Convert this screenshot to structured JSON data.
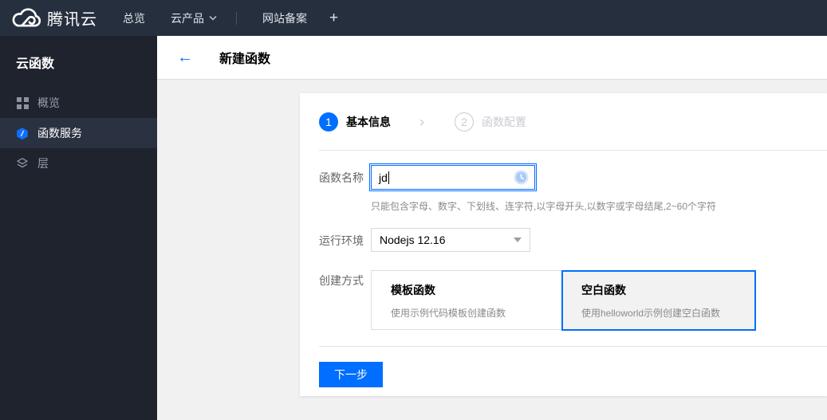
{
  "colors": {
    "accent": "#006eff",
    "topnav_bg": "#262f3e",
    "sidebar_bg": "#1e232e",
    "sidebar_selected_bg": "#2a3140",
    "content_bg": "#f1f1f1",
    "muted_text": "#8a8a8a"
  },
  "topnav": {
    "brand": "腾讯云",
    "items": [
      {
        "label": "总览"
      },
      {
        "label": "云产品"
      },
      {
        "label": "网站备案"
      },
      {
        "label": "+"
      }
    ]
  },
  "sidebar": {
    "title": "云函数",
    "items": [
      {
        "label": "概览",
        "icon": "overview-grid-icon",
        "selected": false
      },
      {
        "label": "函数服务",
        "icon": "function-service-hexagon-icon",
        "selected": true
      },
      {
        "label": "层",
        "icon": "layers-icon",
        "selected": false
      }
    ]
  },
  "header": {
    "back": "←",
    "title": "新建函数"
  },
  "wizard": {
    "separator": "›",
    "steps": [
      {
        "number": "1",
        "label": "基本信息",
        "active": true
      },
      {
        "number": "2",
        "label": "函数配置",
        "active": false
      }
    ]
  },
  "form": {
    "name_label": "函数名称",
    "name_value": "jd",
    "name_status_icon": "pending-clock-icon",
    "name_hint": "只能包含字母、数字、下划线、连字符,以字母开头,以数字或字母结尾,2~60个字符",
    "runtime_label": "运行环境",
    "runtime_value": "Nodejs 12.16",
    "method_label": "创建方式",
    "methods": [
      {
        "title": "模板函数",
        "desc": "使用示例代码模板创建函数",
        "selected": false
      },
      {
        "title": "空白函数",
        "desc": "使用helloworld示例创建空白函数",
        "selected": true
      }
    ],
    "next_button": "下一步"
  }
}
